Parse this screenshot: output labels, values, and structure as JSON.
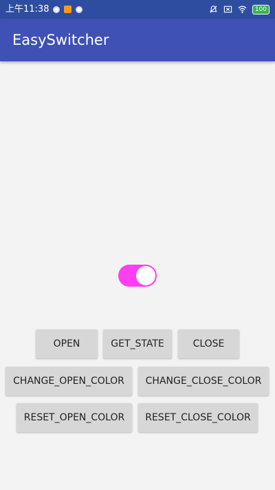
{
  "status_bar": {
    "time": "上午11:38",
    "battery": "100",
    "icons": [
      "notification-circle-icon",
      "app-notification-icon",
      "notification-circle-icon",
      "mute-icon",
      "close-box-icon",
      "wifi-icon",
      "battery-icon"
    ]
  },
  "app_bar": {
    "title": "EasySwitcher",
    "color": "#3f51b5"
  },
  "switcher": {
    "state": "open",
    "open_color": "#ff3df2"
  },
  "buttons": {
    "open": "OPEN",
    "get_state": "GET_STATE",
    "close": "CLOSE",
    "change_open_color": "CHANGE_OPEN_COLOR",
    "change_close_color": "CHANGE_CLOSE_COLOR",
    "reset_open_color": "RESET_OPEN_COLOR",
    "reset_close_color": "RESET_CLOSE_COLOR"
  }
}
